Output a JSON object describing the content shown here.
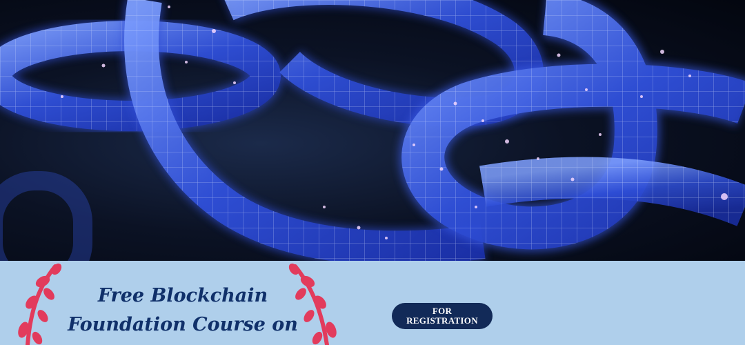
{
  "hero": {
    "image": "blockchain-links-image",
    "colors": {
      "background": "#070d1c",
      "chain": "#3f62e8",
      "chain_light": "#9fb8ff"
    }
  },
  "footer": {
    "background": "#afcfeb",
    "title_lines": [
      "Free Blockchain",
      "Foundation Course on"
    ],
    "title_color": "#10306a",
    "laurel_color": "#e23b5c"
  },
  "cta": {
    "line1": "FOR",
    "line2": "REGISTRATION",
    "background": "#122a58"
  }
}
